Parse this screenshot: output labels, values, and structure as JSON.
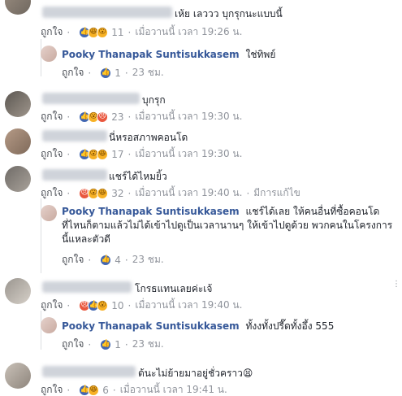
{
  "c1": {
    "text": "เห้ย เลววว บุกรุกนะแบบนี้",
    "like": "ถูกใจ",
    "count": "11",
    "time": "เมื่อวานนี้ เวลา 19:26 น."
  },
  "r1": {
    "name": "Pooky Thanapak Suntisukkasem",
    "text": "ใช่ทิพย์",
    "like": "ถูกใจ",
    "count": "1",
    "time": "23 ชม."
  },
  "c2": {
    "text": "บุกรุก",
    "like": "ถูกใจ",
    "count": "23",
    "time": "เมื่อวานนี้ เวลา 19:30 น."
  },
  "c3": {
    "text": "นี่หรอสภาพคอนโด",
    "like": "ถูกใจ",
    "count": "17",
    "time": "เมื่อวานนี้ เวลา 19:30 น."
  },
  "c4": {
    "text": "แชร์ได้ไหมยิ้ว",
    "like": "ถูกใจ",
    "count": "32",
    "time": "เมื่อวานนี้ เวลา 19:40 น.",
    "edited": "มีการแก้ไข"
  },
  "r4": {
    "name": "Pooky Thanapak Suntisukkasem",
    "text": "แชร์ได้เลย ให้คนอื่นที่ซื้อคอนโดที่ไหนก็ตามแล้วไม่ได้เข้าไปดูเป็นเวลานานๆ ให้เข้าไปดูด้วย พวกคนในโครงการนี้แหละตัวดี",
    "like": "ถูกใจ",
    "count": "4",
    "time": "23 ชม."
  },
  "c5": {
    "text": "โกรธแทนเลยค่ะเจ้",
    "like": "ถูกใจ",
    "count": "10",
    "time": "เมื่อวานนี้ เวลา 19:40 น."
  },
  "r5": {
    "name": "Pooky Thanapak Suntisukkasem",
    "text": "ทั้งงทั้งปรี๊ดทั้งอึ้ง 555",
    "like": "ถูกใจ",
    "count": "1",
    "time": "23 ชม."
  },
  "c6": {
    "text": "ต้นะไม่ย้ายมาอยู่ชั่วคราว😫",
    "like": "ถูกใจ",
    "count": "6",
    "time": "เมื่อวานนี้ เวลา 19:41 น."
  },
  "colors": {
    "link": "#365899",
    "meta": "#90949c",
    "like": "#4267b2"
  }
}
